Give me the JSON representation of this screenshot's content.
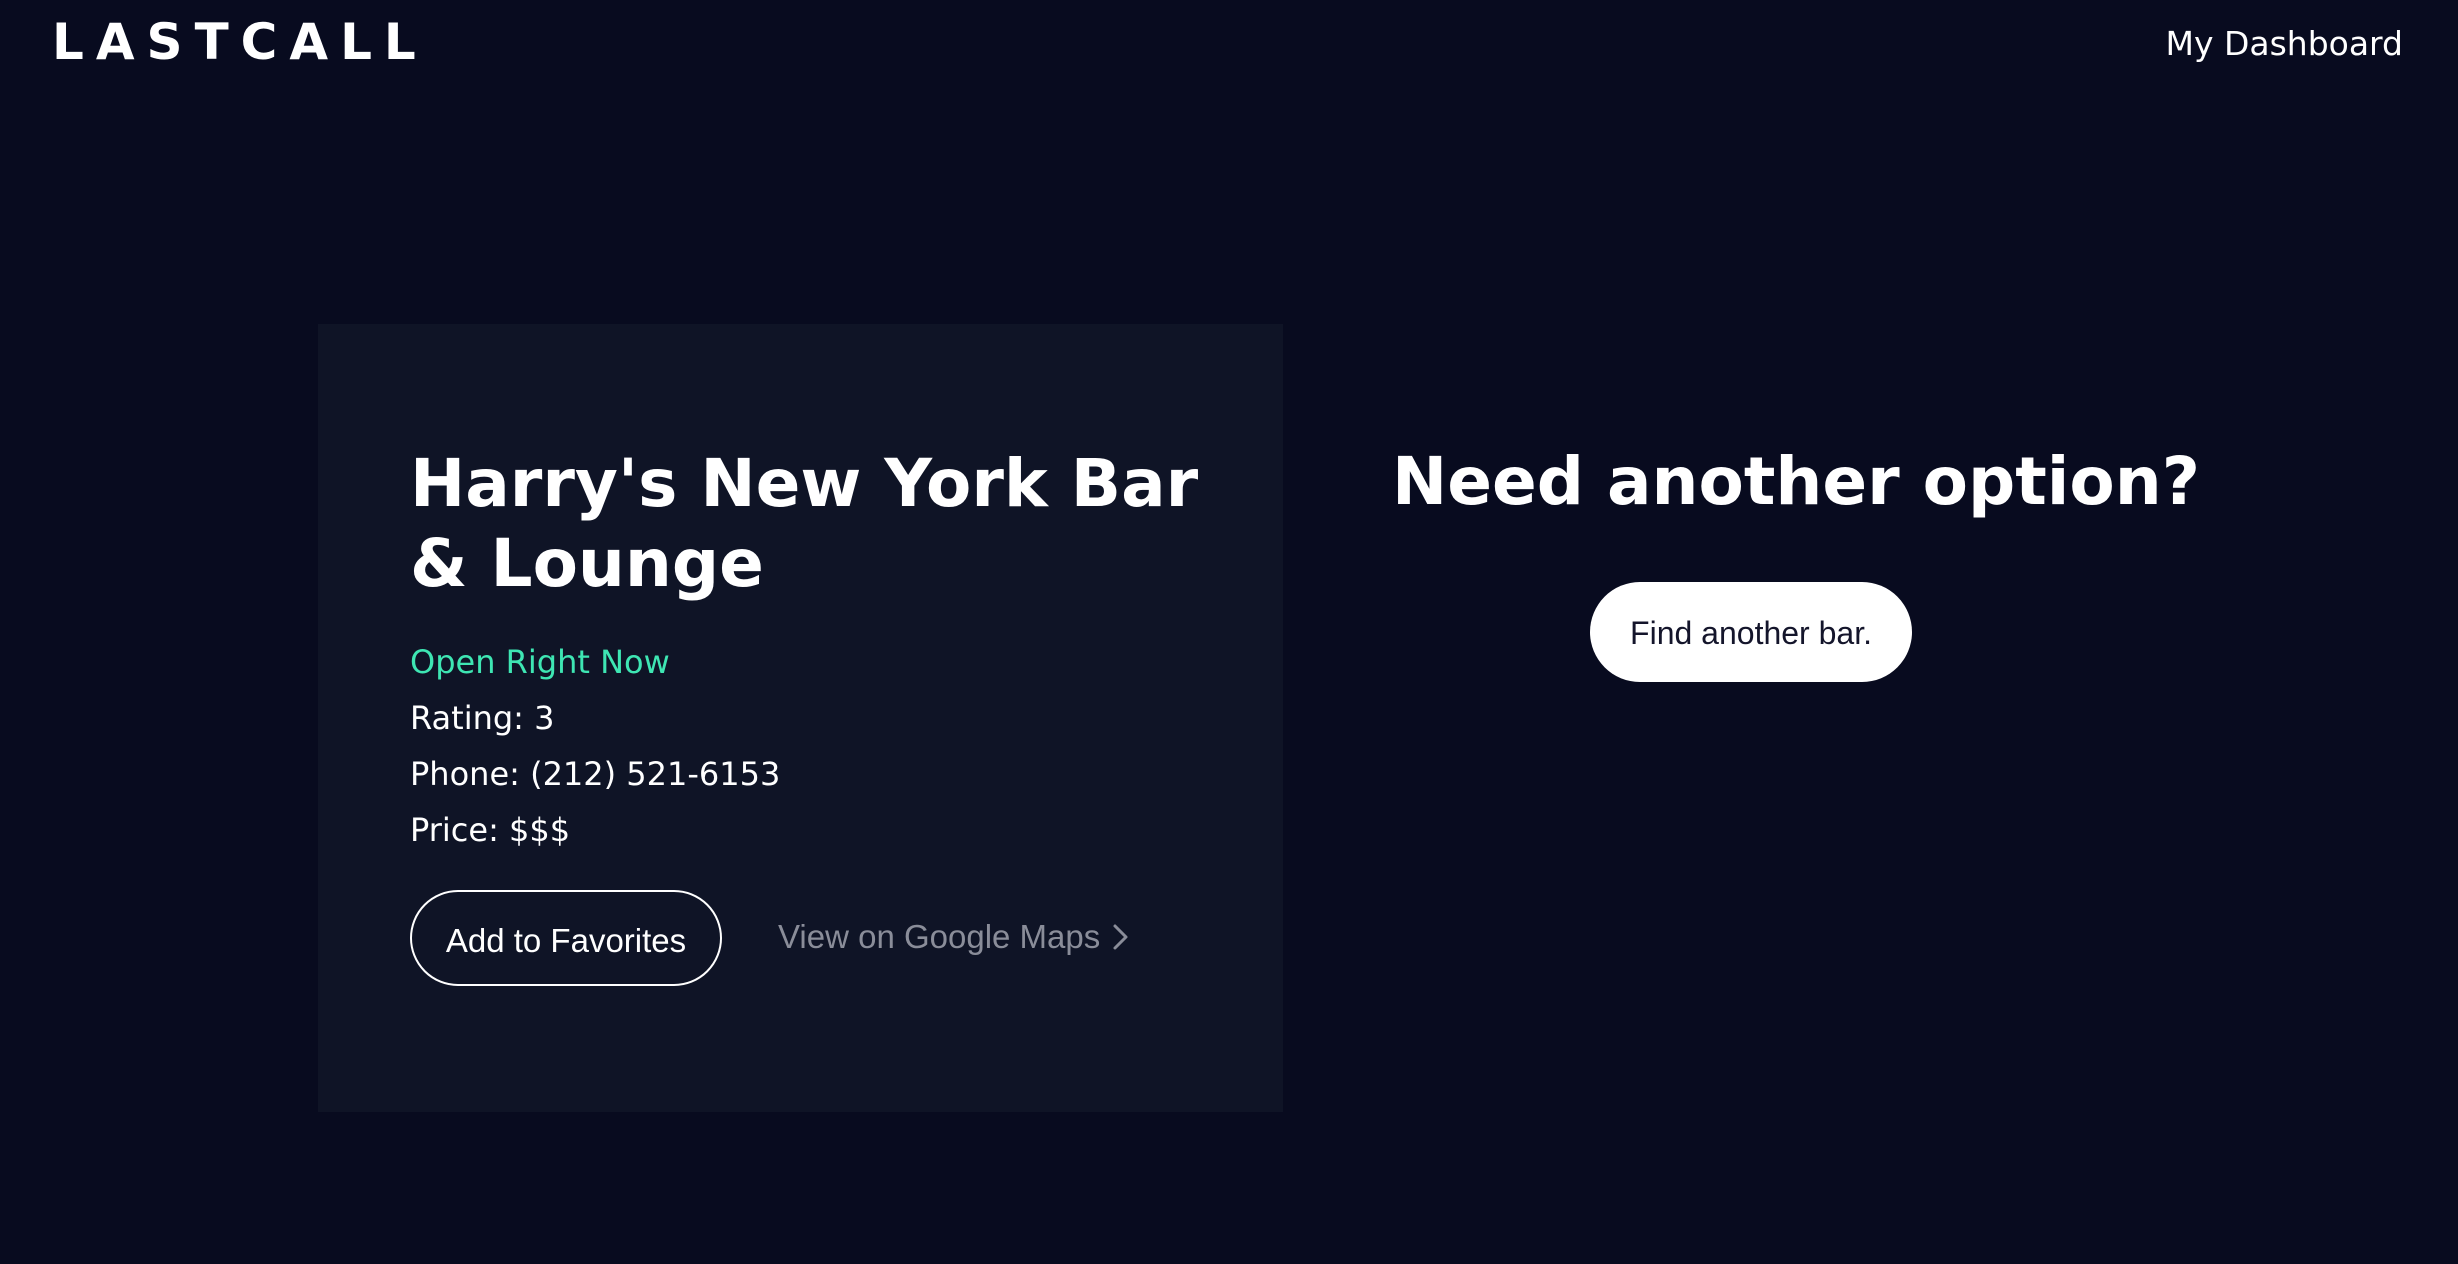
{
  "header": {
    "logo": "LASTCALL",
    "dashboard_link": "My Dashboard"
  },
  "bar": {
    "name": "Harry's New York Bar & Lounge",
    "status": "Open Right Now",
    "rating": "Rating: 3",
    "phone": "Phone: (212) 521-6153",
    "price": "Price: $$$",
    "favorite_button": "Add to Favorites",
    "maps_link": "View on Google Maps",
    "maps_icon": "chevron-right-icon"
  },
  "alternative": {
    "heading": "Need another option?",
    "find_button": "Find another bar."
  },
  "colors": {
    "background": "#080b1f",
    "card": "#0f1426",
    "status_open": "#3ee6b3",
    "muted_link": "#8a8d99"
  }
}
